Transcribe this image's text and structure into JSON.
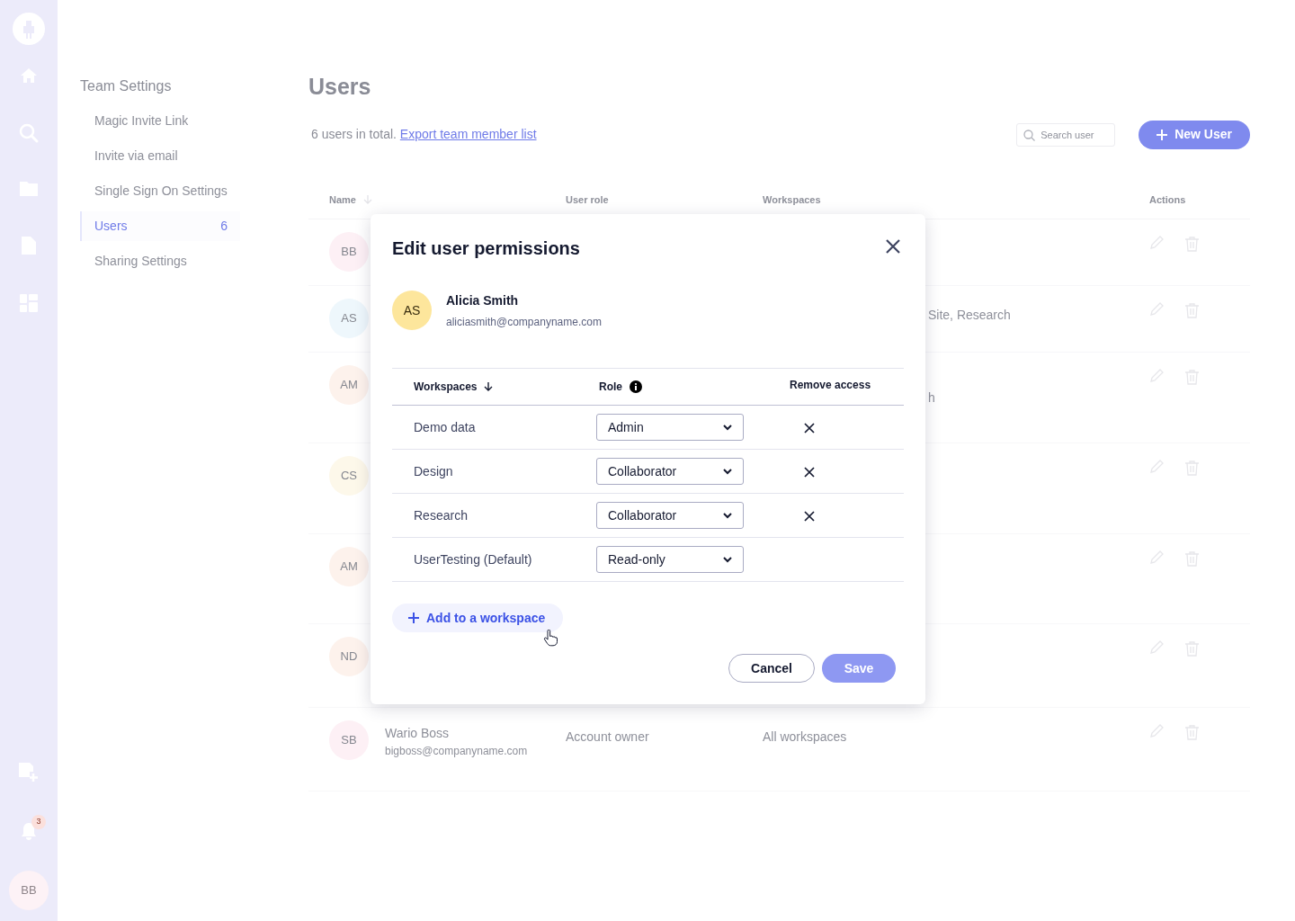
{
  "sidebar": {
    "notification_count": "3",
    "user_initials": "BB"
  },
  "settings_nav": {
    "title": "Team Settings",
    "items": [
      {
        "label": "Magic Invite Link",
        "selected": false
      },
      {
        "label": "Invite via email",
        "selected": false
      },
      {
        "label": "Single Sign On Settings",
        "selected": false
      },
      {
        "label": "Users",
        "count": "6",
        "selected": true
      },
      {
        "label": "Sharing Settings",
        "selected": false
      }
    ]
  },
  "users_page": {
    "title": "Users",
    "summary": "6 users in total.",
    "export_link": "Export team member list",
    "search": {
      "placeholder": "Search user"
    },
    "new_user_button": "New User",
    "table": {
      "columns": [
        "Name",
        "User role",
        "Workspaces",
        "Actions"
      ],
      "rows": [
        {
          "initials": "BB",
          "color": "#fdf0f5"
        },
        {
          "initials": "AS",
          "color": "#eef7fc",
          "workspaces": "Site, Research"
        },
        {
          "initials": "AM",
          "color": "#fdf2ec",
          "workspaces": "h"
        },
        {
          "initials": "CS",
          "color": "#fdf8ea"
        },
        {
          "initials": "AM",
          "color": "#fdf2ec"
        },
        {
          "initials": "ND",
          "color": "#fdf2ec"
        },
        {
          "initials": "SB",
          "color": "#fdf0f5",
          "name": "Wario Boss",
          "email": "bigboss@companyname.com",
          "role": "Account owner",
          "workspaces": "All workspaces"
        }
      ]
    }
  },
  "modal": {
    "title": "Edit user permissions",
    "user": {
      "initials": "AS",
      "color": "#fde69c",
      "name": "Alicia Smith",
      "email": "aliciasmith@companyname.com"
    },
    "columns": [
      "Workspaces",
      "Role",
      "Remove access"
    ],
    "rows": [
      {
        "workspace": "Demo data",
        "role": "Admin",
        "removable": true
      },
      {
        "workspace": "Design",
        "role": "Collaborator",
        "removable": true
      },
      {
        "workspace": "Research",
        "role": "Collaborator",
        "removable": true
      },
      {
        "workspace": "UserTesting (Default)",
        "role": "Read-only",
        "removable": false
      }
    ],
    "add_button": "Add to a workspace",
    "cancel_button": "Cancel",
    "save_button": {
      "label": "Save",
      "disabled": true
    }
  }
}
